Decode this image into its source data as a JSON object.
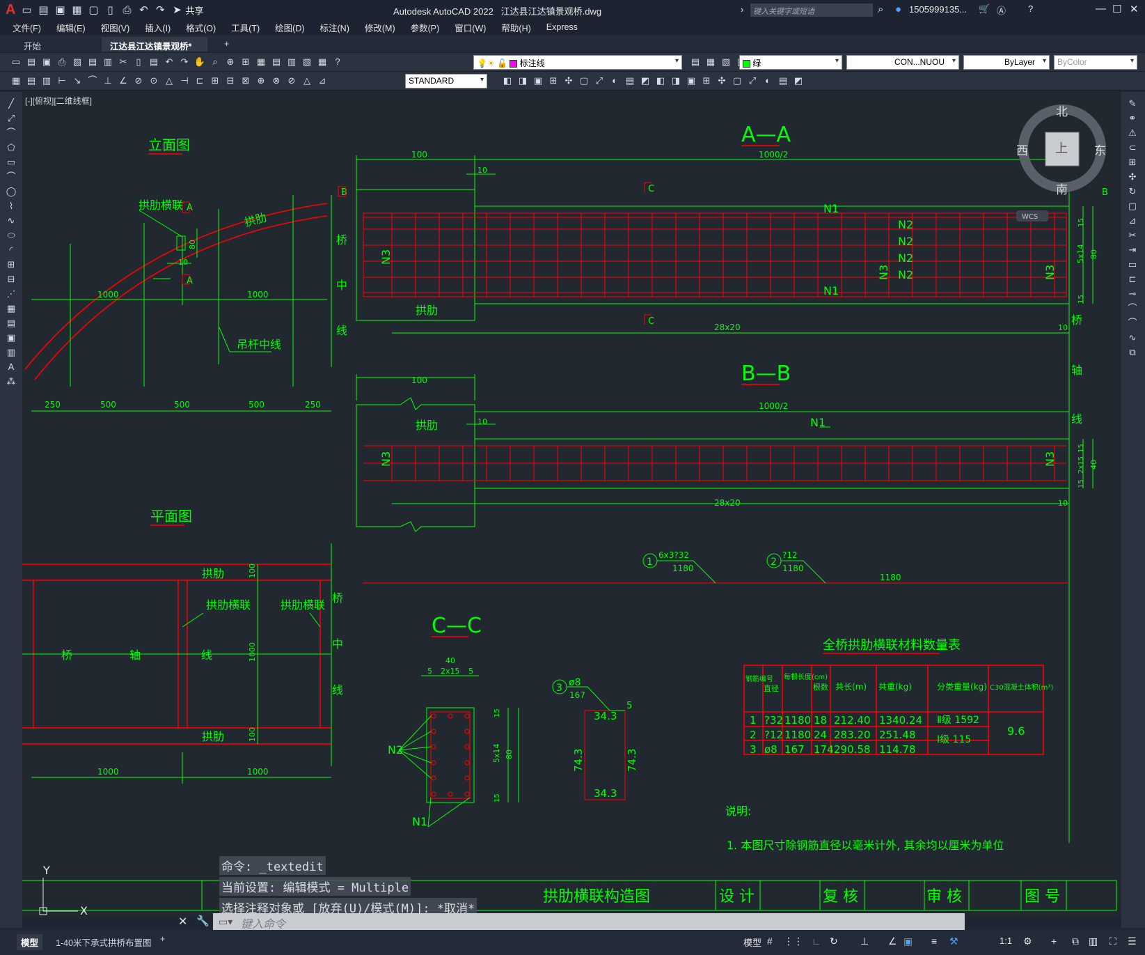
{
  "titlebar": {
    "app_title": "Autodesk AutoCAD 2022",
    "file_name": "江达县江达镇景观桥.dwg",
    "share_label": "共享",
    "search_placeholder": "键入关键字或短语",
    "user": "1505999135..."
  },
  "menu": [
    "文件(F)",
    "编辑(E)",
    "视图(V)",
    "插入(I)",
    "格式(O)",
    "工具(T)",
    "绘图(D)",
    "标注(N)",
    "修改(M)",
    "参数(P)",
    "窗口(W)",
    "帮助(H)",
    "Express"
  ],
  "tabs": {
    "start": "开始",
    "drawing": "江达县江达镇景观桥*"
  },
  "toolbar": {
    "layer_value": "标注线",
    "color_value": "绿",
    "linetype_value": "CON...NUOU",
    "lineweight_value": "ByLayer",
    "plotstyle_value": "ByColor",
    "textstyle_value": "STANDARD"
  },
  "view_label": "[-][俯视][二维线框]",
  "viewcube": {
    "north": "北",
    "south": "南",
    "east": "东",
    "west": "西",
    "top": "上",
    "wcs": "WCS"
  },
  "drawing": {
    "elevation_title": "立面图",
    "plan_title": "平面图",
    "section_aa": "A—A",
    "section_bb": "B—B",
    "section_cc": "C—C",
    "labels": {
      "rib_tie": "拱肋横联",
      "rib": "拱肋",
      "hanger_axis": "吊杆中线",
      "bridge": "桥",
      "middle": "中",
      "line": "线",
      "axis": "轴",
      "n1": "N1",
      "n2": "N2",
      "n3": "N3"
    },
    "dims": {
      "d100": "100",
      "d1000_2": "1000/2",
      "d10": "10",
      "d28x20": "28x20",
      "d1000": "1000",
      "d250": "250",
      "d500": "500",
      "d80": "80",
      "d5x14": "5x14",
      "d15": "15",
      "d2x15": "2x15",
      "d40": "40",
      "d5": "5",
      "d1180": "1180",
      "d343": "34.3",
      "d743": "74.3",
      "d167": "167"
    },
    "rebar": {
      "r1": "6x3?32",
      "r2": "?12",
      "r3": "ø8",
      "n_1": "1",
      "n_2": "2",
      "n_3": "3"
    },
    "table": {
      "title": "全桥拱肋横联材料数量表",
      "headers": [
        "钢筋编号",
        "直径",
        "每根长度(cm)",
        "根数",
        "共长(m)",
        "共重(kg)",
        "分类重量(kg)",
        "C30混凝土体积(m³)"
      ],
      "rows": [
        [
          "1",
          "?32",
          "1180",
          "18",
          "212.40",
          "1340.24"
        ],
        [
          "2",
          "?12",
          "1180",
          "24",
          "283.20",
          "251.48"
        ],
        [
          "3",
          "ø8",
          "167",
          "174",
          "290.58",
          "114.78"
        ]
      ],
      "class_weight_1": "Ⅱ级 1592",
      "class_weight_2": "Ⅰ级 115",
      "concrete": "9.6"
    },
    "notes_title": "说明:",
    "note_1": "1. 本图尺寸除钢筋直径以毫米计外, 其余均以厘米为单位",
    "title_block": {
      "name": "拱肋横联构造图",
      "design": "设 计",
      "review": "复 核",
      "audit": "审 核",
      "drawing_no": "图 号"
    },
    "ucs": {
      "y": "Y",
      "x": "X"
    }
  },
  "command": {
    "line1": "命令: _textedit",
    "line2": "当前设置: 编辑模式 = Multiple",
    "line3": "选择注释对象或 [放弃(U)/模式(M)]: *取消*",
    "placeholder": "键入命令"
  },
  "status": {
    "model_tab": "模型",
    "layout_tab": "1-40米下承式拱桥布置图",
    "model_btn": "模型",
    "scale": "1:1"
  },
  "colors": {
    "green": "#00ff00",
    "red": "#ff0000",
    "canvas": "#212830"
  }
}
